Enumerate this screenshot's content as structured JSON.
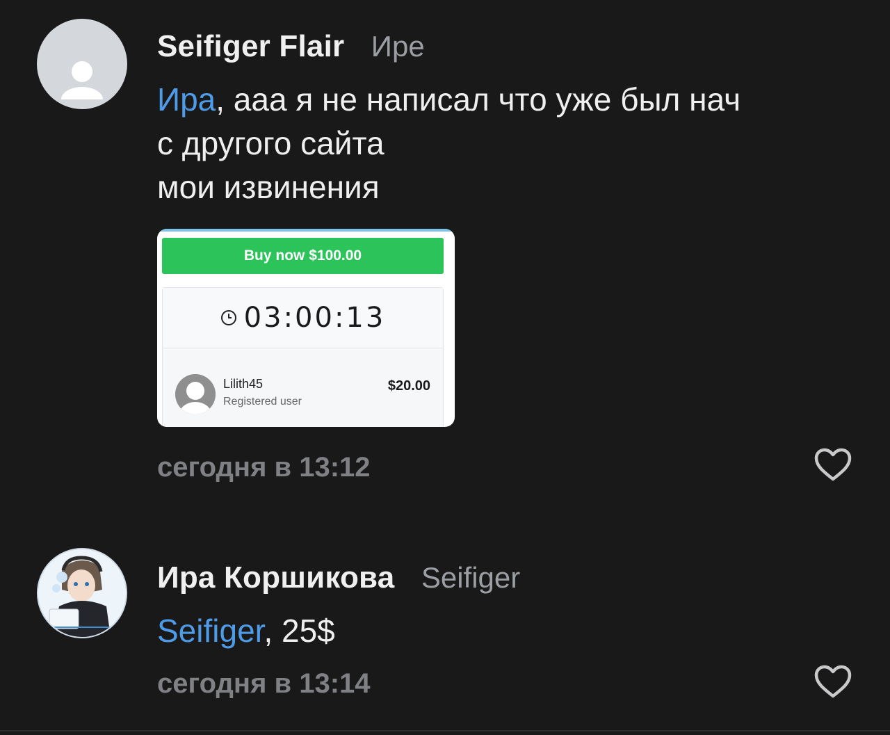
{
  "comments": [
    {
      "author": "Seifiger Flair",
      "reply_to": "Ире",
      "mention": "Ира",
      "text_rest": ", ааа я не написал что уже был нач",
      "line2": "с другого сайта",
      "line3": "мои извинения",
      "time": "сегодня в 13:12",
      "avatar_icon": "user-placeholder-icon",
      "like_icon": "heart-outline-icon",
      "attachment": {
        "buy_label": "Buy now $100.00",
        "timer": "03:00:13",
        "bidder_name": "Lilith45",
        "bidder_role": "Registered user",
        "bidder_amount": "$20.00"
      }
    },
    {
      "author": "Ира Коршикова",
      "reply_to": "Seifiger",
      "mention": "Seifiger",
      "text_rest": ", 25$",
      "time": "сегодня в 13:14",
      "avatar_icon": "illustrated-avatar",
      "like_icon": "heart-outline-icon"
    }
  ],
  "colors": {
    "background": "#19191a",
    "mention": "#4e9ce8",
    "meta": "#7f8185",
    "buy_button": "#2cc35a"
  }
}
